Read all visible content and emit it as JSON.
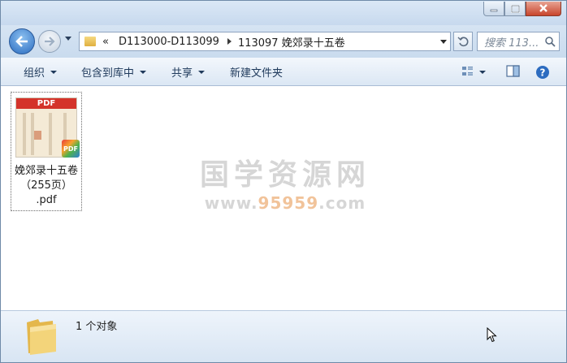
{
  "window": {
    "caption_buttons": {
      "minimize": "minimize",
      "maximize": "maximize",
      "close": "close"
    }
  },
  "nav": {
    "breadcrumb_overflow": "«",
    "breadcrumb": [
      "D113000-D113099",
      "113097 娩郊录十五卷"
    ],
    "search_placeholder": "搜索 113..."
  },
  "toolbar": {
    "organize": "组织",
    "include_in_library": "包含到库中",
    "share": "共享",
    "new_folder": "新建文件夹"
  },
  "content": {
    "file": {
      "thumbnail_banner": "PDF",
      "badge": "PDF",
      "name_line1": "娩郊录十五卷",
      "name_line2": "（255页）",
      "name_line3": ".pdf"
    },
    "watermark": {
      "title": "国学资源网",
      "url_prefix": "www.",
      "url_highlight": "95959",
      "url_suffix": ".com"
    }
  },
  "status": {
    "item_count": "1 个对象"
  },
  "colors": {
    "accent": "#2a6cc0",
    "toolbar_text": "#1e395b",
    "close_button": "#c8452c"
  }
}
